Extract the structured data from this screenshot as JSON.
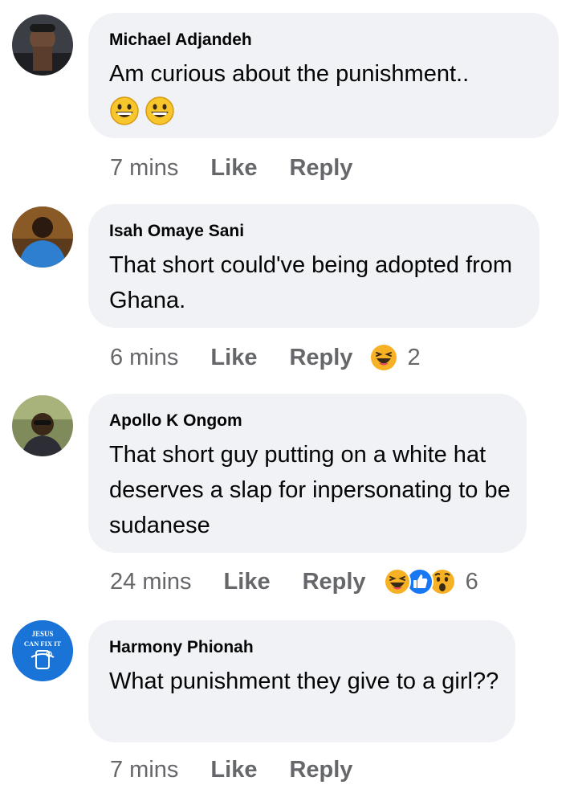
{
  "comments": [
    {
      "author": "Michael Adjandeh",
      "text": "Am curious about the punishment..",
      "emojis": [
        "grinning-face",
        "grinning-face"
      ],
      "time": "7 mins",
      "like_label": "Like",
      "reply_label": "Reply",
      "reactions": [],
      "reaction_count": ""
    },
    {
      "author": "Isah Omaye Sani",
      "text": "That short could've being adopted from Ghana.",
      "time": "6 mins",
      "like_label": "Like",
      "reply_label": "Reply",
      "reactions": [
        "haha"
      ],
      "reaction_count": "2"
    },
    {
      "author": "Apollo K Ongom",
      "text": "That short guy putting on a white hat deserves a slap for inpersonating to be sudanese",
      "time": "24 mins",
      "like_label": "Like",
      "reply_label": "Reply",
      "reactions": [
        "haha",
        "like",
        "wow"
      ],
      "reaction_count": "6"
    },
    {
      "author": "Harmony Phionah",
      "text": "What punishment  they give to a girl??",
      "avatar_text": "JESUS CAN FIX IT",
      "time": "7 mins",
      "like_label": "Like",
      "reply_label": "Reply",
      "reactions": [],
      "reaction_count": ""
    }
  ],
  "colors": {
    "bubble_bg": "#f0f2f5",
    "text": "#050505",
    "meta_text": "#65676b",
    "reaction_yellow": "#f7b125",
    "like_blue": "#1877f2"
  }
}
